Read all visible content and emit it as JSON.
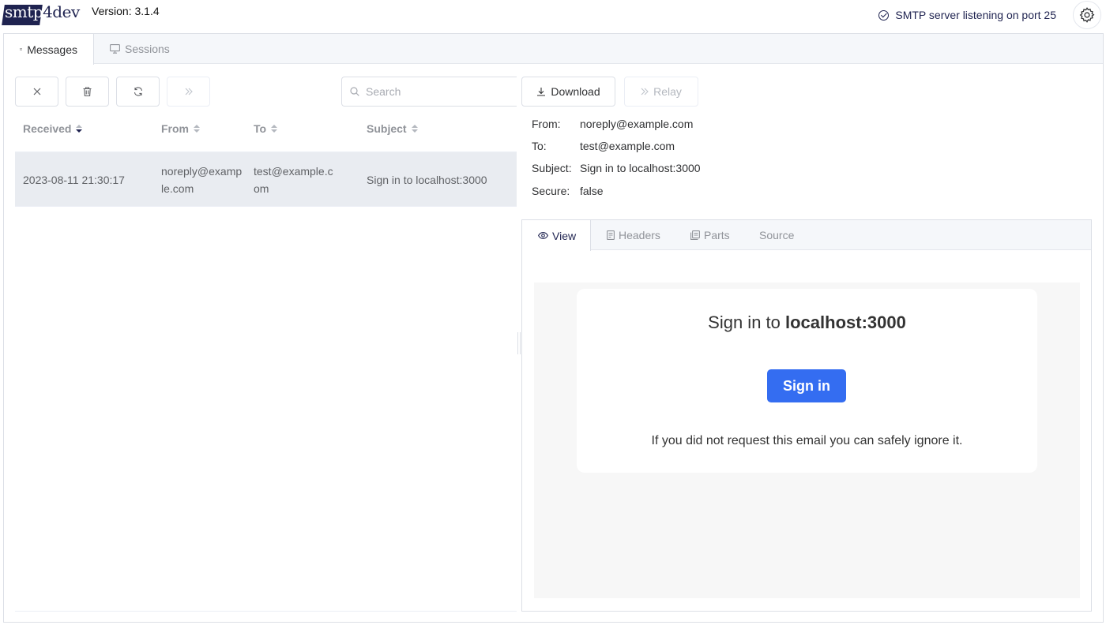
{
  "app": {
    "logo_main": "smtp",
    "logo_tail": "4dev",
    "version_label": "Version: 3.1.4",
    "status_text": "SMTP server listening on port 25"
  },
  "tabs": [
    {
      "label": "Messages",
      "icon": "mail-icon",
      "active": true
    },
    {
      "label": "Sessions",
      "icon": "monitor-icon",
      "active": false
    }
  ],
  "toolbar": {
    "search_placeholder": "Search",
    "search_value": ""
  },
  "table": {
    "columns": [
      "Received",
      "From",
      "To",
      "Subject"
    ],
    "sort": {
      "column": "Received",
      "direction": "descending"
    },
    "rows": [
      {
        "received": "2023-08-11 21:30:17",
        "from_line1": "noreply@examp",
        "from_line2": "le.com",
        "to_line1": "test@example.c",
        "to_line2": "om",
        "subject": "Sign in to localhost:3000"
      }
    ]
  },
  "detail": {
    "download_label": "Download",
    "relay_label": "Relay",
    "fields": {
      "from_label": "From:",
      "from_value": "noreply@example.com",
      "to_label": "To:",
      "to_value": "test@example.com",
      "subject_label": "Subject:",
      "subject_value": "Sign in to localhost:3000",
      "secure_label": "Secure:",
      "secure_value": "false"
    },
    "tabs": [
      {
        "label": "View",
        "icon": "eye-icon",
        "active": true
      },
      {
        "label": "Headers",
        "icon": "document-icon",
        "active": false
      },
      {
        "label": "Parts",
        "icon": "files-icon",
        "active": false
      },
      {
        "label": "Source",
        "icon": "",
        "active": false
      }
    ]
  },
  "email": {
    "title_prefix": "Sign in to ",
    "title_host": "localhost:3000",
    "button_label": "Sign in",
    "footer": "If you did not request this email you can safely ignore it."
  },
  "colors": {
    "brand_navy": "#1f2350",
    "email_button": "#346df1",
    "selected_row": "#e9ecf1",
    "preview_background": "#f7f7f7"
  }
}
